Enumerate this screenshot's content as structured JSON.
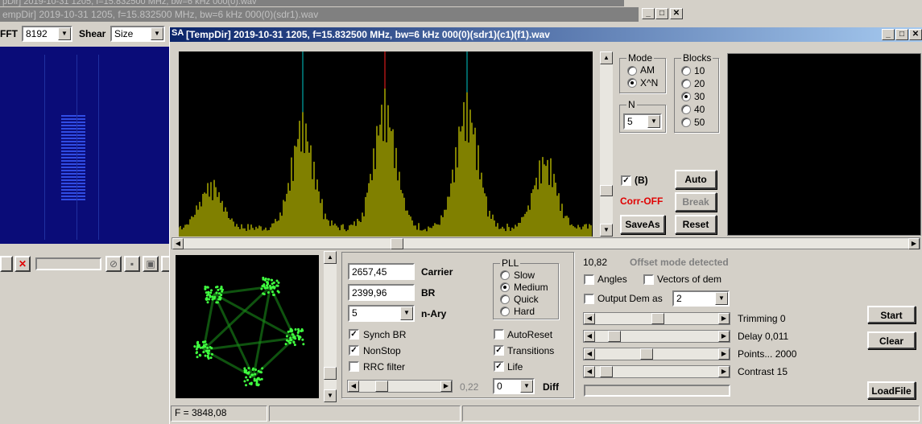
{
  "bg_titles": {
    "top": "pDir] 2019-10-31 1205, f=15.832500 MHz, bw=6 kHz 000(0).wav",
    "second": "empDir] 2019-10-31 1205, f=15.832500 MHz, bw=6 kHz 000(0)(sdr1).wav"
  },
  "left_panel": {
    "fft_label": "FFT",
    "fft_value": "8192",
    "shear_label": "Shear",
    "shear_value": "Size"
  },
  "main": {
    "title_icon": "SA",
    "title": "[TempDir] 2019-10-31 1205, f=15.832500 MHz, bw=6 kHz 000(0)(sdr1)(c1)(f1).wav",
    "mode": {
      "label": "Mode",
      "options": [
        "AM",
        "X^N"
      ],
      "selected": "X^N"
    },
    "blocks": {
      "label": "Blocks",
      "options": [
        "10",
        "20",
        "30",
        "40",
        "50"
      ],
      "selected": "30"
    },
    "n": {
      "label": "N",
      "value": "5"
    },
    "b_check": {
      "label": "(B)",
      "checked": true
    },
    "corr_status": "Corr-OFF",
    "auto_button": "Auto",
    "break_button": "Break",
    "saveas_button": "SaveAs",
    "reset_button": "Reset",
    "carrier": {
      "value": "2657,45",
      "label": "Carrier"
    },
    "br": {
      "value": "2399,96",
      "label": "BR"
    },
    "nary": {
      "value": "5",
      "label": "n-Ary"
    },
    "pll": {
      "label": "PLL",
      "options": [
        "Slow",
        "Medium",
        "Quick",
        "Hard"
      ],
      "selected": "Medium"
    },
    "synch_br": {
      "label": "Synch BR",
      "checked": true
    },
    "nonstop": {
      "label": "NonStop",
      "checked": true
    },
    "rrc": {
      "label": "RRC filter",
      "checked": false
    },
    "autoreset": {
      "label": "AutoReset",
      "checked": false
    },
    "transitions": {
      "label": "Transitions",
      "checked": true
    },
    "life": {
      "label": "Life",
      "checked": true
    },
    "slider_value": "0,22",
    "diff": {
      "value": "0",
      "label": "Diff"
    },
    "offset_value": "10,82",
    "offset_text": "Offset mode detected",
    "angles": {
      "label": "Angles",
      "checked": false
    },
    "vectors": {
      "label": "Vectors of dem",
      "checked": false
    },
    "output_dem": {
      "label": "Output Dem as",
      "checked": false,
      "value": "2"
    },
    "trimming": "Trimming 0",
    "delay": "Delay  0,011",
    "points": "Points... 2000",
    "contrast": "Contrast 15",
    "start_button": "Start",
    "clear_button": "Clear",
    "loadfile_button": "LoadFile",
    "status_f": "F = 3848,08",
    "colors": {
      "spectrum": "#ffff00",
      "cyan_marker": "#00c8c8",
      "red_marker": "#ff2020",
      "constellation": "#40ff40",
      "corr": "#e00000"
    }
  }
}
